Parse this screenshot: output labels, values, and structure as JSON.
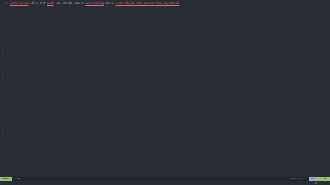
{
  "buffer": {
    "line_number": "1",
    "segments": [
      {
        "text": "Lorem ipsum",
        "spell": true
      },
      {
        "text": " dolor sit ",
        "spell": false
      },
      {
        "text": "amet",
        "spell": true
      },
      {
        "text": ", qui minim labore ",
        "spell": false
      },
      {
        "text": "adipisicing",
        "spell": true
      },
      {
        "text": " minim ",
        "spell": false
      },
      {
        "text": "sint cillum sint consectetur cupidatat",
        "spell": true
      },
      {
        "text": ".",
        "spell": false
      }
    ]
  },
  "statusline": {
    "mode": "NORMAL",
    "filename": "a.md[+]",
    "right_info": "5  ⌘ markdown",
    "percent": "100%",
    "position": "1:75"
  },
  "cmdline": {
    "right": "45"
  },
  "colors": {
    "background": "#282c34",
    "text": "#abb2bf",
    "spell_error": "#e06c75",
    "mode_bg": "#98c379",
    "statusline_bg": "#21252b"
  }
}
